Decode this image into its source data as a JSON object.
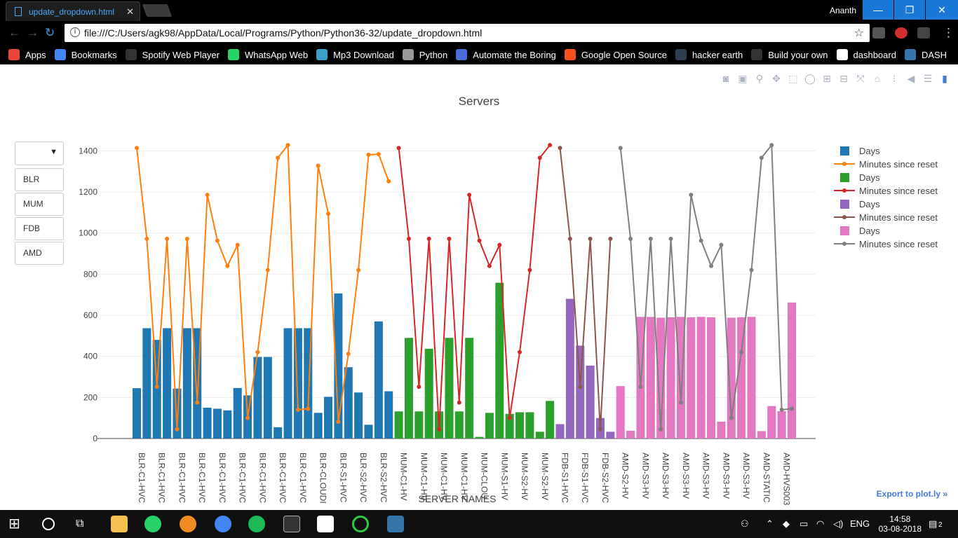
{
  "browser": {
    "tab_title": "update_dropdown.html",
    "user": "Ananth",
    "url": "file:///C:/Users/agk98/AppData/Local/Programs/Python/Python36-32/update_dropdown.html",
    "bookmarks": [
      {
        "label": "Apps",
        "color": "#e8453c"
      },
      {
        "label": "Bookmarks",
        "color": "#4285f4"
      },
      {
        "label": "Spotify Web Player",
        "color": "#333333"
      },
      {
        "label": "WhatsApp Web",
        "color": "#25d366"
      },
      {
        "label": "Mp3 Download",
        "color": "#3aa0c8"
      },
      {
        "label": "Python",
        "color": "#999999"
      },
      {
        "label": "Automate the Boring",
        "color": "#4a6fdc"
      },
      {
        "label": "Google Open Source",
        "color": "#f4511e"
      },
      {
        "label": "hacker earth",
        "color": "#2d3e50"
      },
      {
        "label": "Build your own",
        "color": "#333333"
      },
      {
        "label": "dashboard",
        "color": "#ffffff"
      },
      {
        "label": "DASH",
        "color": "#3776ab"
      }
    ]
  },
  "dropdown": {
    "selected": "",
    "options": [
      "BLR",
      "MUM",
      "FDB",
      "AMD"
    ]
  },
  "export_link": "Export to plot.ly »",
  "chart_data": {
    "type": "bar",
    "title": "Servers",
    "xlabel": "SERVER NAMES",
    "ylabel": "",
    "ylim": [
      0,
      1500
    ],
    "yticks": [
      0,
      200,
      400,
      600,
      800,
      1000,
      1200,
      1400
    ],
    "grid": true,
    "legend_position": "right",
    "tick_labels": [
      "BLR-C1-HVC",
      "BLR-C1-HVC",
      "BLR-C1-HVC",
      "BLR-C1-HVC",
      "BLR-C1-HVC",
      "BLR-C1-HVC",
      "BLR-C1-HVC",
      "BLR-C1-HVC",
      "BLR-C1-HVC",
      "BLR-CLOUDI",
      "BLR-S1-HVC",
      "BLR-S2-HVC",
      "BLR-S2-HVC",
      "MUM-C1-HV",
      "MUM-C1-HV",
      "MUM-C1-HV",
      "MUM-C1-HV",
      "MUM-CLOU",
      "MUM-S1-HV",
      "MUM-S2-HV",
      "MUM-S2-HV",
      "FDB-S1-HVC",
      "FDB-S1-HVC",
      "FDB-S2-HVC",
      "AMD-S2-HV",
      "AMD-S3-HV",
      "AMD-S3-HV",
      "AMD-S3-HV",
      "AMD-S3-HV",
      "AMD-S3-HV",
      "AMD-S3-HV",
      "AMD-STATIC",
      "AMD-HVS003"
    ],
    "series": [
      {
        "name": "Days",
        "type": "bar",
        "color": "#1f77b4",
        "values": [
          245,
          537,
          480,
          537,
          243,
          537,
          537,
          150,
          145,
          137,
          246,
          210,
          397,
          397,
          55,
          537,
          537,
          537,
          125,
          203,
          706,
          347,
          224,
          67,
          570,
          230
        ]
      },
      {
        "name": "Minutes since reset",
        "type": "line",
        "color": "#ff7f0e",
        "values": [
          1414,
          972,
          252,
          972,
          45,
          972,
          175,
          1186,
          963,
          840,
          942,
          100,
          420,
          820,
          1366,
          1428,
          140,
          145,
          1328,
          1094,
          82,
          412,
          820,
          1381,
          1384,
          1252
        ]
      },
      {
        "name": "Days",
        "type": "bar",
        "color": "#2ca02c",
        "values": [
          132,
          490,
          132,
          437,
          132,
          490,
          132,
          490,
          8,
          125,
          758,
          120,
          128,
          128,
          33,
          183
        ]
      },
      {
        "name": "Minutes since reset",
        "type": "line",
        "color": "#d62728",
        "values": [
          1414,
          972,
          252,
          972,
          45,
          972,
          175,
          1186,
          963,
          840,
          942,
          100,
          420,
          820,
          1366,
          1428
        ]
      },
      {
        "name": "Days",
        "type": "bar",
        "color": "#9467bd",
        "values": [
          70,
          680,
          452,
          355,
          100,
          33
        ]
      },
      {
        "name": "Minutes since reset",
        "type": "line",
        "color": "#8c564b",
        "values": [
          1414,
          972,
          252,
          972,
          45,
          972
        ]
      },
      {
        "name": "Days",
        "type": "bar",
        "color": "#e377c2",
        "values": [
          255,
          38,
          592,
          592,
          588,
          590,
          592,
          590,
          592,
          590,
          82,
          588,
          590,
          592,
          36,
          158,
          133,
          662
        ]
      },
      {
        "name": "Minutes since reset",
        "type": "line",
        "color": "#7f7f7f",
        "values": [
          1414,
          972,
          252,
          972,
          45,
          972,
          175,
          1186,
          963,
          840,
          942,
          100,
          420,
          820,
          1366,
          1428,
          140,
          145
        ]
      }
    ]
  },
  "taskbar": {
    "language": "ENG",
    "time": "14:58",
    "date": "03-08-2018",
    "notifications": "2"
  }
}
